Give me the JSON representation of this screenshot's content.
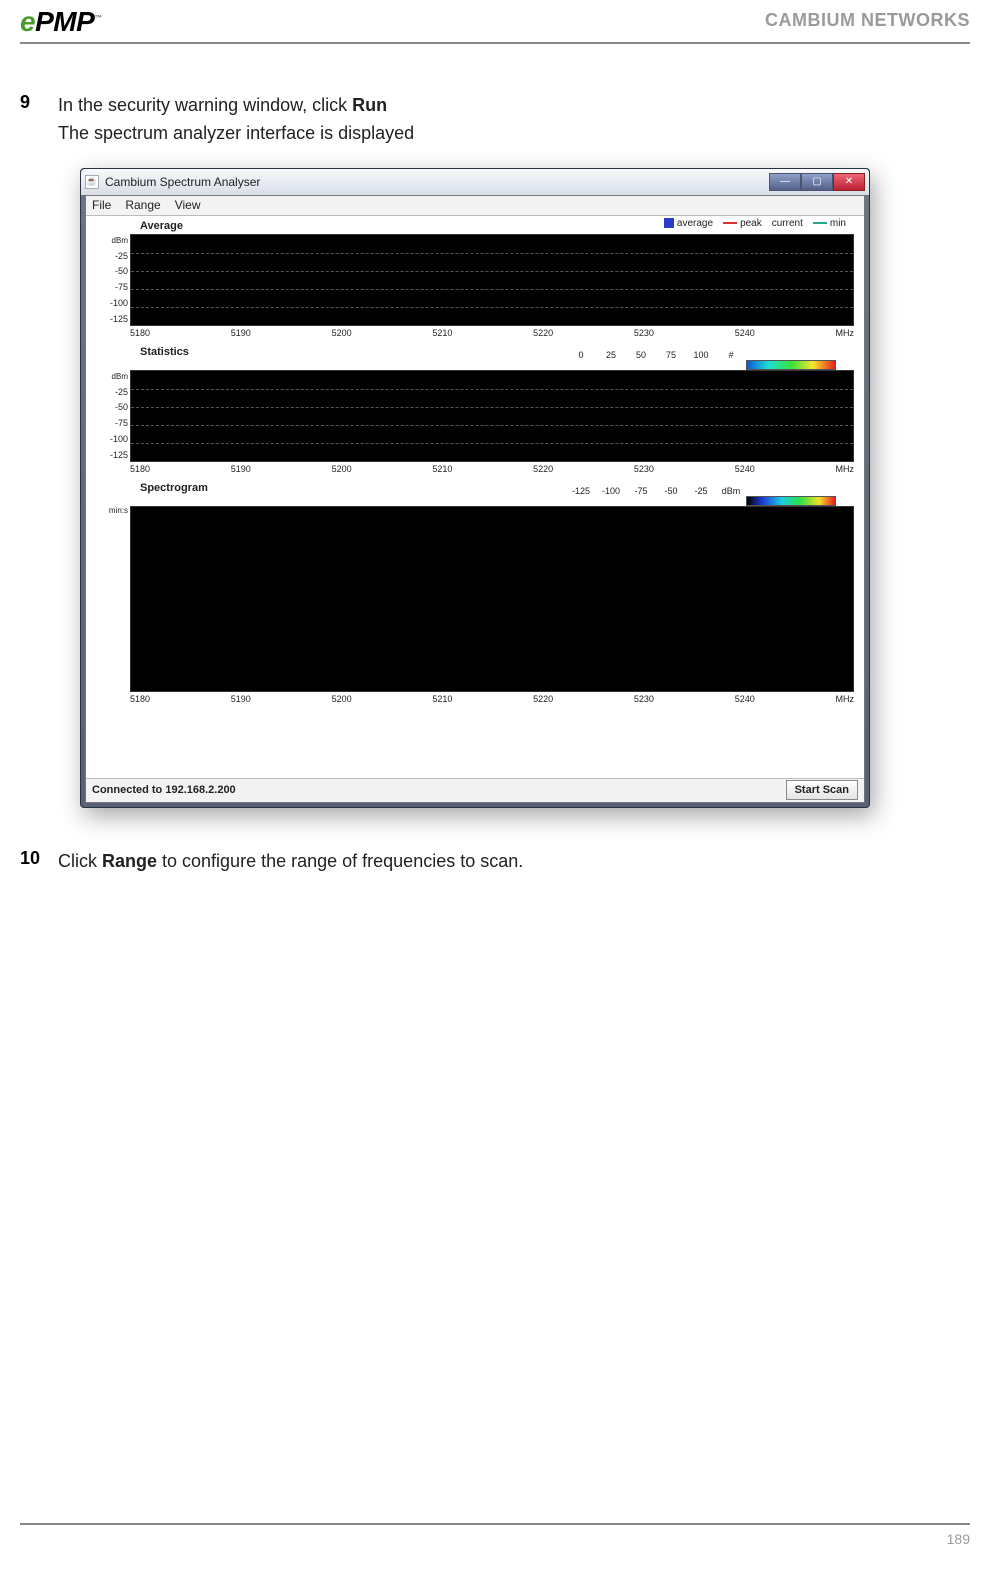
{
  "header": {
    "logo_prefix": "e",
    "logo_text": "PMP",
    "tm": "™",
    "company": "CAMBIUM NETWORKS"
  },
  "steps": {
    "s9": {
      "num": "9",
      "line1_pre": "In the security warning window, click ",
      "line1_bold": "Run",
      "line2": "The spectrum analyzer interface is displayed"
    },
    "s10": {
      "num": "10",
      "pre": "Click ",
      "bold": "Range",
      "post": " to configure the range of frequencies to scan."
    }
  },
  "app": {
    "title": "Cambium Spectrum Analyser",
    "menu": {
      "file": "File",
      "range": "Range",
      "view": "View"
    },
    "legend": {
      "avg": "average",
      "peak": "peak",
      "current": "current",
      "min": "min"
    },
    "panels": {
      "average_title": "Average",
      "statistics_title": "Statistics",
      "spectrogram_title": "Spectrogram"
    },
    "yaxis": {
      "unit_dBm": "dBm",
      "v_25": "-25",
      "v_50": "-50",
      "v_75": "-75",
      "v_100": "-100",
      "v_125": "-125"
    },
    "xaxis": {
      "t5180": "5180",
      "t5190": "5190",
      "t5200": "5200",
      "t5210": "5210",
      "t5220": "5220",
      "t5230": "5230",
      "t5240": "5240",
      "unit": "MHz"
    },
    "statsbar": {
      "l0": "0",
      "l25": "25",
      "l50": "50",
      "l75": "75",
      "l100": "100",
      "hash": "#"
    },
    "specbar": {
      "ln125": "-125",
      "ln100": "-100",
      "ln75": "-75",
      "ln50": "-50",
      "ln25": "-25",
      "unit": "dBm"
    },
    "spectrogram_ylabel": "min:s",
    "status": "Connected to 192.168.2.200",
    "start_scan": "Start Scan"
  },
  "footer": {
    "page": "189"
  },
  "chart_data": [
    {
      "type": "line",
      "title": "Average",
      "xlabel": "MHz",
      "ylabel": "dBm",
      "x_ticks": [
        5180,
        5190,
        5200,
        5210,
        5220,
        5230,
        5240
      ],
      "y_ticks": [
        -25,
        -50,
        -75,
        -100,
        -125
      ],
      "ylim": [
        -125,
        -25
      ],
      "series": [
        {
          "name": "average",
          "values": []
        },
        {
          "name": "peak",
          "values": []
        },
        {
          "name": "current",
          "values": []
        },
        {
          "name": "min",
          "values": []
        }
      ],
      "note": "Plot area is blank (no scan running)"
    },
    {
      "type": "line",
      "title": "Statistics",
      "xlabel": "MHz",
      "ylabel": "dBm",
      "x_ticks": [
        5180,
        5190,
        5200,
        5210,
        5220,
        5230,
        5240
      ],
      "y_ticks": [
        -25,
        -50,
        -75,
        -100,
        -125
      ],
      "ylim": [
        -125,
        -25
      ],
      "colorbar": {
        "min": 0,
        "max": 100,
        "ticks": [
          0,
          25,
          50,
          75,
          100
        ],
        "unit": "#"
      },
      "note": "Plot area is blank (no scan running)"
    },
    {
      "type": "heatmap",
      "title": "Spectrogram",
      "xlabel": "MHz",
      "ylabel": "min:s",
      "x_ticks": [
        5180,
        5190,
        5200,
        5210,
        5220,
        5230,
        5240
      ],
      "colorbar": {
        "min": -125,
        "max": -25,
        "ticks": [
          -125,
          -100,
          -75,
          -50,
          -25
        ],
        "unit": "dBm"
      },
      "note": "Plot area is blank (no scan running)"
    }
  ]
}
